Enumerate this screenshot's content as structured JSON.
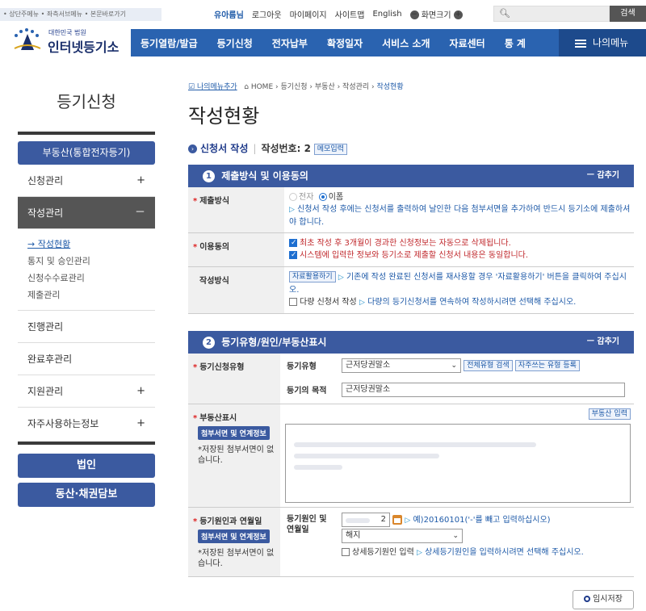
{
  "util_links": [
    "• 상단주메뉴",
    "• 좌측서브메뉴",
    "• 본문바로가기"
  ],
  "header": {
    "user": "유아름님",
    "logout": "로그아웃",
    "mypage": "마이페이지",
    "sitemap": "사이트맵",
    "english": "English",
    "zoom_label": "화면크기",
    "search_btn": "검색"
  },
  "logo": {
    "sub": "대한민국 법원",
    "main": "인터넷등기소"
  },
  "nav": {
    "items": [
      "등기열람/발급",
      "등기신청",
      "전자납부",
      "확정일자",
      "서비스 소개",
      "자료센터",
      "통 계"
    ],
    "mymenu": "나의메뉴"
  },
  "sidebar": {
    "title": "등기신청",
    "category": "부동산(통합전자등기)",
    "menu": [
      {
        "label": "신청관리",
        "pm": "+"
      },
      {
        "label": "작성관리",
        "pm": "－"
      },
      {
        "label": "진행관리",
        "pm": ""
      },
      {
        "label": "완료후관리",
        "pm": ""
      },
      {
        "label": "지원관리",
        "pm": "+"
      },
      {
        "label": "자주사용하는정보",
        "pm": "+"
      }
    ],
    "sub": [
      "→ 작성현황",
      "통지 및 승인관리",
      "신청수수료관리",
      "제출관리"
    ],
    "btn1": "법인",
    "btn2": "동산·채권담보"
  },
  "breadcrumb": {
    "add": "나의메뉴추가",
    "path": "HOME › 등기신청 › 부동산 › 작성관리 › ",
    "current": "작성현황"
  },
  "page_title": "작성현황",
  "doc": {
    "label": "신청서 작성",
    "no_label": "작성번호: 2",
    "memo_btn": "메모입력"
  },
  "section1": {
    "num": "1",
    "title": "제출방식 및 이용동의",
    "fold": "ㅡ 감추기",
    "submit_label": "제출방식",
    "opt_e": "전자",
    "opt_paper": "이폼",
    "submit_note": "신청서 작성 후에는 신청서를 출력하여 날인한 다음 첨부서면을 추가하여 반드시 등기소에 제출하셔야 합니다.",
    "agree_label": "이용동의",
    "agree1": "최초 작성 후 3개월이 경과한 신청정보는 자동으로 삭제됩니다.",
    "agree2": "시스템에 입력한 정보와 등기소로 제출할 신청서 내용은 동일합니다.",
    "method_label": "작성방식",
    "reuse_btn": "자료활용하기",
    "reuse_note": "기존에 작성 완료된 신청서를 재사용할 경우 '자료활용하기' 버튼을 클릭하여 주십시오.",
    "multi_label": "다량 신청서 작성",
    "multi_note": "다량의 등기신청서를 연속하여 작성하시려면 선택해 주십시오."
  },
  "section2": {
    "num": "2",
    "title": "등기유형/원인/부동산표시",
    "fold": "ㅡ 감추기",
    "type_label": "등기신청유형",
    "kind_label": "등기유형",
    "kind_value": "근저당권말소",
    "all_types_btn": "전체유형 검색",
    "freq_types_btn": "자주쓰는 유형 등록",
    "purpose_label": "등기의 목적",
    "purpose_value": "근저당권말소",
    "prop_label": "부동산표시",
    "attach_btn": "첨부서면 및 연계정보",
    "no_attach": "*저장된 첨부서면이 없습니다.",
    "prop_input_btn": "부동산 입력",
    "cause_label": "등기원인과 연월일",
    "cause_date_label": "등기원인 및 연월일",
    "date_suffix": "2",
    "date_note": "예)20160101('-'를 빼고 입력하십시오)",
    "cause_value": "해지",
    "detail_label": "상세등기원인 입력",
    "detail_note": "상세등기원인을 입력하시려면 선택해 주십시오."
  },
  "save_btn": "임시저장"
}
